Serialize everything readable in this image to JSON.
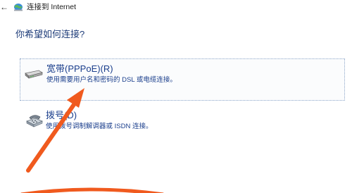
{
  "window": {
    "back_glyph": "←",
    "title": "连接到 Internet"
  },
  "main": {
    "question": "你希望如何连接?"
  },
  "options": [
    {
      "title": "宽带(PPPoE)(R)",
      "description": "使用需要用户名和密码的 DSL 或电缆连接。",
      "icon": "broadband-modem-icon",
      "selected": true
    },
    {
      "title": "拨号(D)",
      "description": "使用拨号调制解调器或 ISDN 连接。",
      "icon": "dialup-phone-icon",
      "selected": false
    }
  ],
  "annotation": {
    "color": "#f05a1e"
  }
}
